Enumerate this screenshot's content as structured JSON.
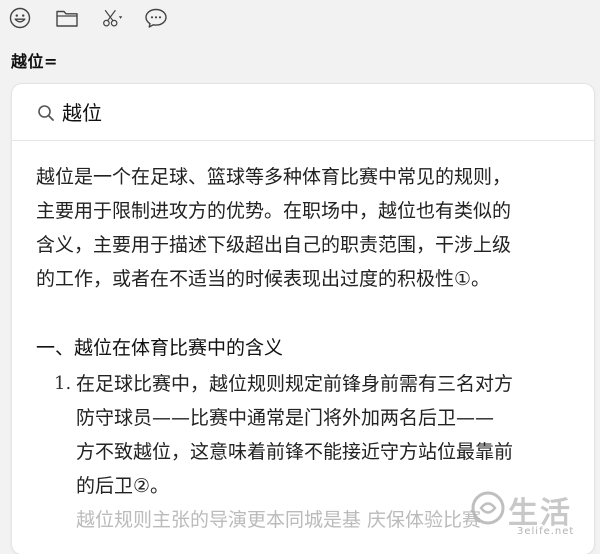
{
  "toolbar": {
    "icons": [
      "emoji-icon",
      "folder-icon",
      "scissors-icon",
      "chat-bubble-icon"
    ]
  },
  "input_line": "越位=",
  "search": {
    "query": "越位"
  },
  "article": {
    "intro_lines": [
      "越位是一个在足球、篮球等多种体育比赛中常见的规则，",
      "主要用于限制进攻方的优势。在职场中，越位也有类似的",
      "含义，主要用于描述下级超出自己的职责范围，干涉上级",
      "的工作，或者在不适当的时候表现出过度的积极性①。"
    ],
    "section_title": "一、越位在体育比赛中的含义",
    "list": [
      {
        "number": "1.",
        "lines": [
          "在足球比赛中，越位规则规定前锋身前需有三名对方",
          "防守球员——比赛中通常是门将外加两名后卫——",
          "方不致越位，这意味着前锋不能接近守方站位最靠前",
          "的后卫②。"
        ]
      }
    ],
    "cutoff_line": "越位规则主张的导演更本同城是基 庆保体验比赛"
  },
  "watermark": {
    "text": "生活",
    "url": "3elife.net"
  },
  "colors": {
    "background": "#f2f2f2",
    "card": "#ffffff",
    "text": "#222222"
  }
}
